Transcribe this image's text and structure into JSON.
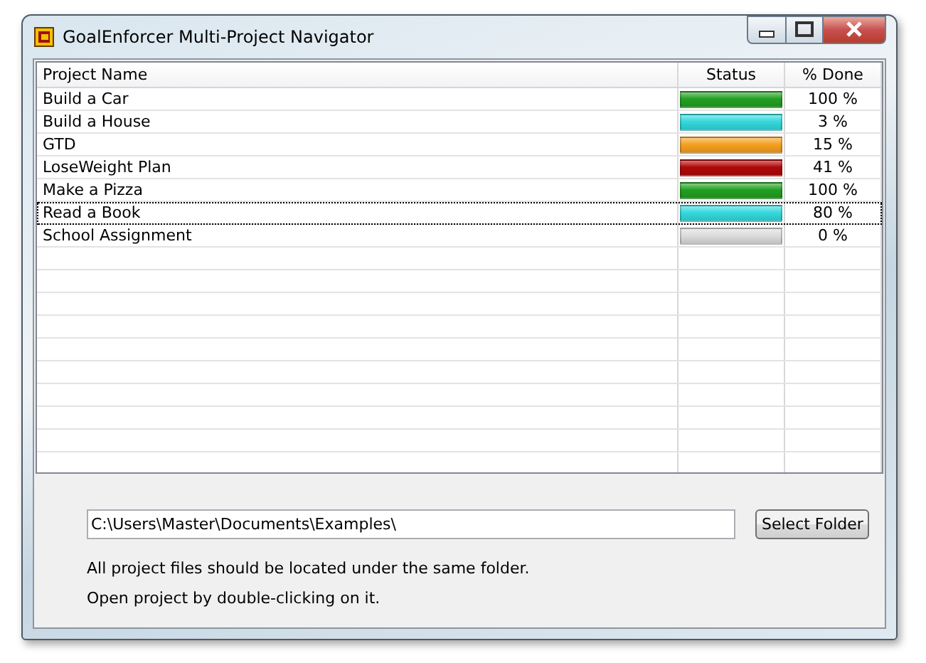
{
  "window": {
    "title": "GoalEnforcer Multi-Project Navigator"
  },
  "table": {
    "columns": [
      "Project Name",
      "Status",
      "% Done"
    ],
    "rows": [
      {
        "name": "Build a Car",
        "color": "#22a022",
        "done": "100 %",
        "selected": false
      },
      {
        "name": "Build a House",
        "color": "#33d8dc",
        "done": "3 %",
        "selected": false
      },
      {
        "name": "GTD",
        "color": "#f5a020",
        "done": "15 %",
        "selected": false
      },
      {
        "name": "LoseWeight Plan",
        "color": "#b00808",
        "done": "41 %",
        "selected": false
      },
      {
        "name": "Make a Pizza",
        "color": "#22a022",
        "done": "100 %",
        "selected": false
      },
      {
        "name": "Read a Book",
        "color": "#33d8dc",
        "done": "80 %",
        "selected": true
      },
      {
        "name": "School Assignment",
        "color": "#dcdcdc",
        "done": "0 %",
        "selected": false
      }
    ]
  },
  "folder": {
    "value": "C:\\Users\\Master\\Documents\\Examples\\",
    "button": "Select Folder"
  },
  "notes": [
    "All project files should be located under the same folder.",
    "Open project by double-clicking on it."
  ]
}
